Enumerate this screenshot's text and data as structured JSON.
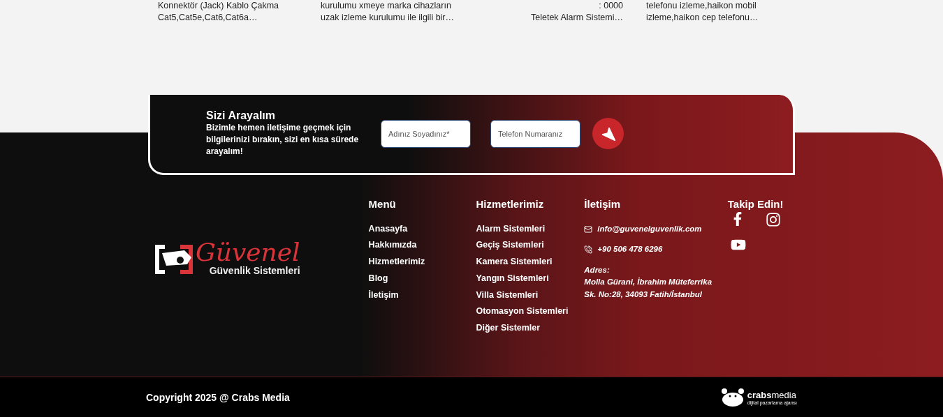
{
  "top_cards": [
    {
      "kind": "text",
      "lines": [
        "Konnektör (Jack) Kablo Çakma",
        "Cat5,Cat5e,Cat6,Cat6a…"
      ]
    },
    {
      "kind": "text",
      "lines": [
        "kurulumu xmeye marka cihazların",
        "uzak izleme kurulumu ile ilgili bir…"
      ]
    },
    {
      "kind": "table",
      "lines": [
        ":       0000",
        "Teletek Alarm Sistemi…"
      ]
    },
    {
      "kind": "text",
      "lines": [
        "telefonu izleme,haikon mobil",
        "izleme,haikon cep telefonu…"
      ]
    }
  ],
  "callback": {
    "title": "Sizi Arayalım",
    "text": "Bizimle hemen iletişime geçmek için bilgilerinizi bırakın, sizi en kısa sürede arayalım!",
    "fields": [
      {
        "placeholder": "Adınız Soyadınız*"
      },
      {
        "placeholder": "Telefon Numaranız"
      }
    ]
  },
  "brand": {
    "name": "Güvenel",
    "tagline": "Güvenlik Sistemleri"
  },
  "menu": {
    "title": "Menü",
    "links": [
      "Anasayfa",
      "Hakkımızda",
      "Hizmetlerimiz",
      "Blog",
      "İletişim"
    ]
  },
  "services": {
    "title": "Hizmetlerimiz",
    "links": [
      "Alarm Sistemleri",
      "Geçiş Sistemleri",
      "Kamera Sistemleri",
      "Yangın Sistemleri",
      "Villa Sistemleri",
      "Otomasyon Sistemleri",
      "Diğer Sistemler"
    ]
  },
  "contact": {
    "title": "İletişim",
    "email": "info@guvenelguvenlik.com",
    "phone": "+90 506 478 6296",
    "address_label": "Adres:",
    "address_lines": [
      "Molla Gürani, İbrahim Müteferrika",
      "Sk. No:28, 34093 Fatih/İstanbul"
    ]
  },
  "social": {
    "title": "Takip Edin!"
  },
  "copyright": "Copyright 2025 @ Crabs Media",
  "agency": {
    "name": "**crabs**media",
    "tagline": "dijital pazarlama ajansı"
  }
}
